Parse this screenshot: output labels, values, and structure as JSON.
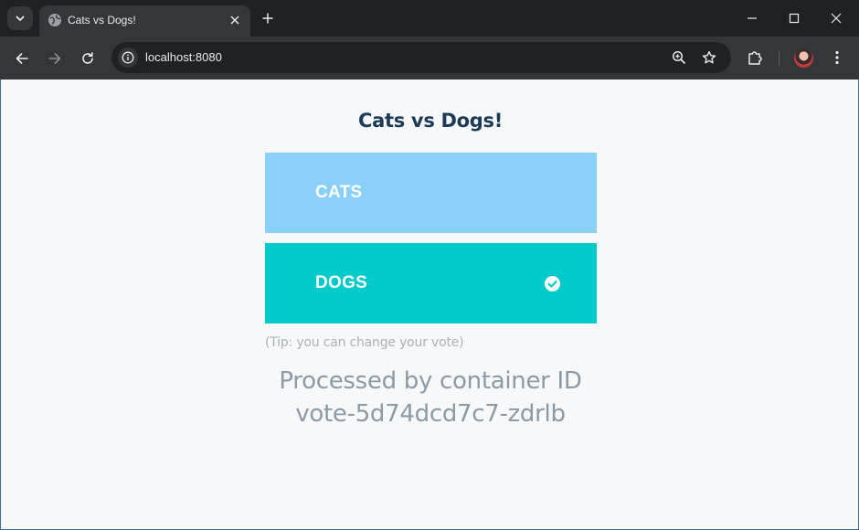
{
  "browser": {
    "tab_title": "Cats vs Dogs!",
    "url": "localhost:8080",
    "icons": {
      "tab_search": "chevron-down-icon",
      "favicon": "globe-icon",
      "tab_close": "close-icon",
      "new_tab": "plus-icon",
      "minimize": "minimize-icon",
      "maximize": "maximize-icon",
      "close_window": "close-icon",
      "back": "arrow-left-icon",
      "forward": "arrow-right-icon",
      "reload": "reload-icon",
      "site_info": "info-icon",
      "zoom": "zoom-icon",
      "bookmark": "star-icon",
      "extensions": "puzzle-icon",
      "menu": "kebab-menu-icon"
    }
  },
  "page": {
    "title": "Cats vs Dogs!",
    "options": [
      {
        "label": "CATS",
        "color": "#8ad0f9",
        "selected": false
      },
      {
        "label": "DOGS",
        "color": "#00cbca",
        "selected": true
      }
    ],
    "tip": "(Tip: you can change your vote)",
    "processed_line1": "Processed by container ID",
    "processed_line2": "vote-5d74dcd7c7-zdrlb"
  }
}
